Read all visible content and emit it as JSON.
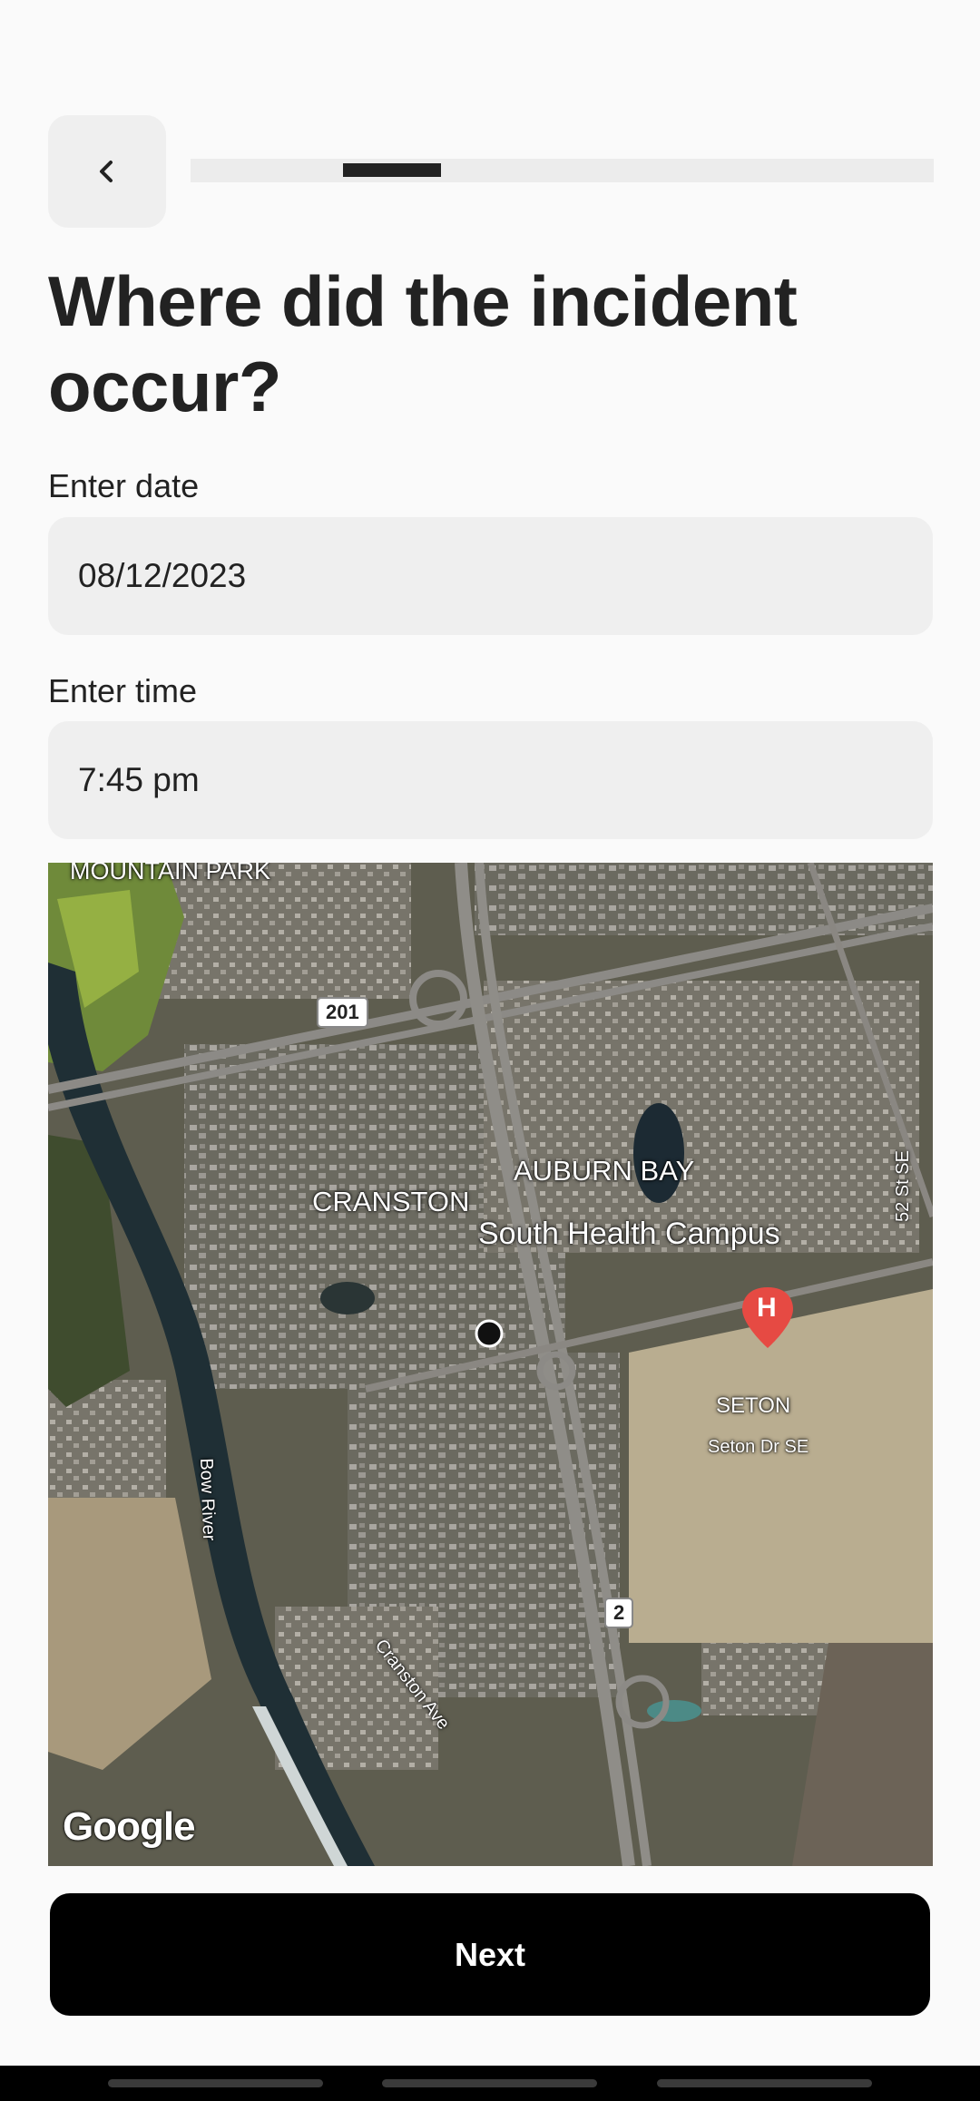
{
  "header": {
    "back_icon": "chevron-left-icon",
    "progress": {
      "value": 0.2,
      "start": 0.205
    }
  },
  "title": "Where did the incident occur?",
  "date_field": {
    "label": "Enter date",
    "value": "08/12/2023"
  },
  "time_field": {
    "label": "Enter time",
    "value": "7:45 pm"
  },
  "map": {
    "labels": {
      "mountain_park": "MOUNTAIN PARK",
      "auburn_bay": "AUBURN BAY",
      "cranston": "CRANSTON",
      "south_health_campus": "South Health Campus",
      "seton": "SETON",
      "seton_dr": "Seton Dr SE",
      "bow_river": "Bow River",
      "cranston_ave": "Cranston Ave",
      "st_52": "52 St SE"
    },
    "shields": {
      "hwy_201": "201",
      "hwy_2": "2"
    },
    "hospital_marker": "H",
    "attribution": "Google"
  },
  "next_button": {
    "label": "Next"
  }
}
